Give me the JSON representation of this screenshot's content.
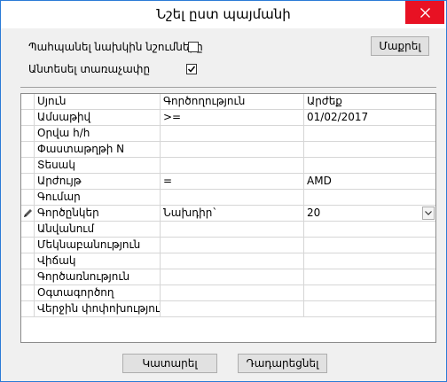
{
  "window": {
    "title": "Նշել ըստ պայմանի",
    "close_icon": "close-icon"
  },
  "options": {
    "keep_previous_label": "Պահպանել նախկին նշումները",
    "keep_previous_checked": false,
    "ignore_case_label": "Անտեսել տառաչափը",
    "ignore_case_checked": true
  },
  "buttons": {
    "clear": "Մաքրել",
    "run": "Կատարել",
    "cancel": "Դադարեցնել"
  },
  "table": {
    "headers": [
      "Սյուն",
      "Գործողություն",
      "Արժեք"
    ],
    "rows": [
      {
        "column": "Ամսաթիվ",
        "operation": ">=",
        "value": "01/02/2017"
      },
      {
        "column": "Օրվա հ/հ",
        "operation": "",
        "value": ""
      },
      {
        "column": "Փաստաթղթի N",
        "operation": "",
        "value": ""
      },
      {
        "column": "Տեսակ",
        "operation": "",
        "value": ""
      },
      {
        "column": "Արժույթ",
        "operation": "=",
        "value": "AMD"
      },
      {
        "column": "Գումար",
        "operation": "",
        "value": ""
      },
      {
        "column": "Գործընկեր",
        "operation": "Նախդիր`",
        "value": "20"
      },
      {
        "column": "Անվանում",
        "operation": "",
        "value": ""
      },
      {
        "column": "Մեկնաբանություն",
        "operation": "",
        "value": ""
      },
      {
        "column": "Վիճակ",
        "operation": "",
        "value": ""
      },
      {
        "column": "Գործառնություն",
        "operation": "",
        "value": ""
      },
      {
        "column": "Օգտագործող",
        "operation": "",
        "value": ""
      },
      {
        "column": "Վերջին փոփոխություն",
        "operation": "",
        "value": ""
      }
    ],
    "editing_row_index": 6,
    "editing_row_icon": "pencil-icon",
    "dropdown_icon": "chevron-down-icon"
  },
  "colors": {
    "close_button": "#e81123",
    "window_border": "#2b7bd6"
  }
}
